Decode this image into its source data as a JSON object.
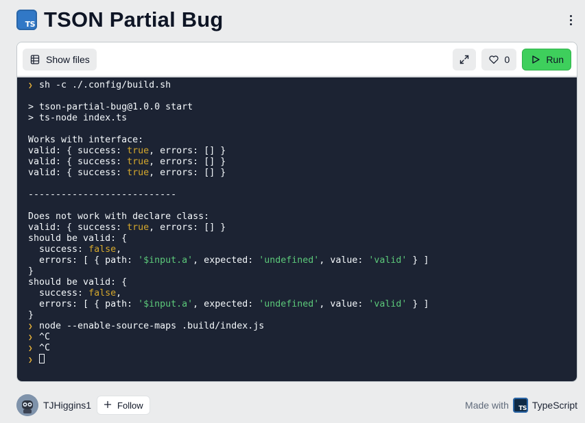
{
  "header": {
    "title": "TSON Partial Bug",
    "logo_text": "TS",
    "menu_icon": "kebab-icon"
  },
  "toolbar": {
    "show_files_label": "Show files",
    "like_count": "0",
    "run_label": "Run",
    "icons": [
      "files-icon",
      "expand-icon",
      "heart-icon",
      "play-icon"
    ]
  },
  "console": {
    "lines": [
      {
        "prompt": true,
        "parts": [
          {
            "t": "sh -c ./.config/build.sh"
          }
        ]
      },
      {
        "parts": []
      },
      {
        "parts": [
          {
            "t": "> tson-partial-bug@1.0.0 start"
          }
        ]
      },
      {
        "parts": [
          {
            "t": "> ts-node index.ts"
          }
        ]
      },
      {
        "parts": []
      },
      {
        "parts": [
          {
            "t": "Works with interface:"
          }
        ]
      },
      {
        "parts": [
          {
            "t": "valid: { success: "
          },
          {
            "t": "true",
            "c": "kw"
          },
          {
            "t": ", errors: [] }"
          }
        ]
      },
      {
        "parts": [
          {
            "t": "valid: { success: "
          },
          {
            "t": "true",
            "c": "kw"
          },
          {
            "t": ", errors: [] }"
          }
        ]
      },
      {
        "parts": [
          {
            "t": "valid: { success: "
          },
          {
            "t": "true",
            "c": "kw"
          },
          {
            "t": ", errors: [] }"
          }
        ]
      },
      {
        "parts": []
      },
      {
        "parts": [
          {
            "t": "---------------------------"
          }
        ]
      },
      {
        "parts": []
      },
      {
        "parts": [
          {
            "t": "Does not work with declare class:"
          }
        ]
      },
      {
        "parts": [
          {
            "t": "valid: { success: "
          },
          {
            "t": "true",
            "c": "kw"
          },
          {
            "t": ", errors: [] }"
          }
        ]
      },
      {
        "parts": [
          {
            "t": "should be valid: {"
          }
        ]
      },
      {
        "parts": [
          {
            "t": "  success: "
          },
          {
            "t": "false",
            "c": "kw"
          },
          {
            "t": ","
          }
        ]
      },
      {
        "parts": [
          {
            "t": "  errors: [ { path: "
          },
          {
            "t": "'$input.a'",
            "c": "str"
          },
          {
            "t": ", expected: "
          },
          {
            "t": "'undefined'",
            "c": "str"
          },
          {
            "t": ", value: "
          },
          {
            "t": "'valid'",
            "c": "str"
          },
          {
            "t": " } ]"
          }
        ]
      },
      {
        "parts": [
          {
            "t": "}"
          }
        ]
      },
      {
        "parts": [
          {
            "t": "should be valid: {"
          }
        ]
      },
      {
        "parts": [
          {
            "t": "  success: "
          },
          {
            "t": "false",
            "c": "kw"
          },
          {
            "t": ","
          }
        ]
      },
      {
        "parts": [
          {
            "t": "  errors: [ { path: "
          },
          {
            "t": "'$input.a'",
            "c": "str"
          },
          {
            "t": ", expected: "
          },
          {
            "t": "'undefined'",
            "c": "str"
          },
          {
            "t": ", value: "
          },
          {
            "t": "'valid'",
            "c": "str"
          },
          {
            "t": " } ]"
          }
        ]
      },
      {
        "parts": [
          {
            "t": "}"
          }
        ]
      },
      {
        "prompt": true,
        "parts": [
          {
            "t": "node --enable-source-maps .build/index.js"
          }
        ]
      },
      {
        "prompt": true,
        "parts": [
          {
            "t": "^C"
          }
        ]
      },
      {
        "prompt": true,
        "parts": [
          {
            "t": "^C"
          }
        ]
      },
      {
        "prompt": true,
        "cursor": true,
        "parts": []
      }
    ],
    "colors": {
      "background": "#1c2333",
      "text": "#f5f9fc",
      "keyword": "#d4a72c",
      "string": "#5cc97a",
      "prompt": "#e5b039"
    }
  },
  "footer": {
    "username": "TJHiggins1",
    "follow_label": "Follow",
    "made_with_label": "Made with",
    "language": "TypeScript",
    "logo_text": "TS"
  },
  "colors": {
    "run_button": "#3ecf5c",
    "typescript_blue": "#3178c6"
  }
}
